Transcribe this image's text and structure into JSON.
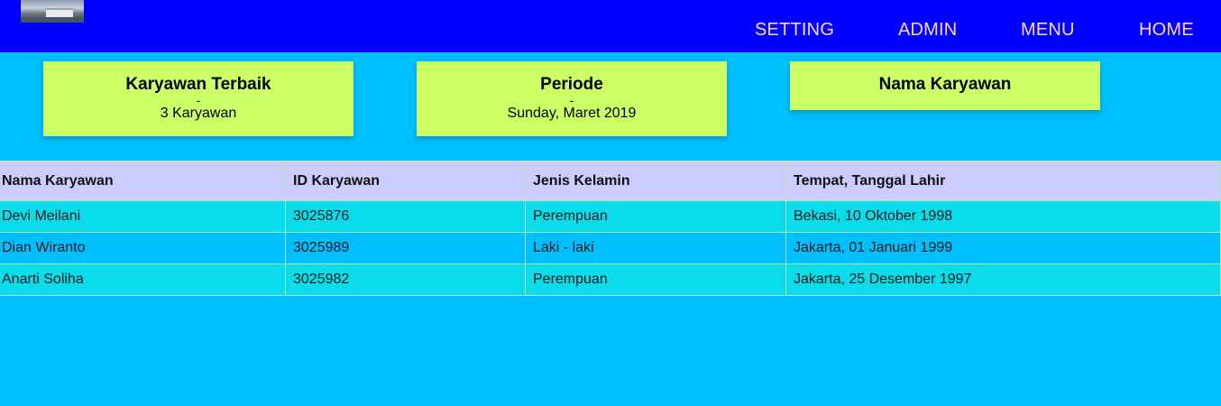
{
  "nav": {
    "links": [
      "SETTING",
      "ADMIN",
      "MENU",
      "HOME"
    ]
  },
  "cards": [
    {
      "title": "Karyawan Terbaik",
      "dash": "-",
      "value": "3 Karyawan"
    },
    {
      "title": "Periode",
      "dash": "-",
      "value": "Sunday, Maret 2019"
    },
    {
      "title": "Nama Karyawan"
    }
  ],
  "table": {
    "headers": [
      "Nama Karyawan",
      "ID Karyawan",
      "Jenis Kelamin",
      "Tempat, Tanggal Lahir"
    ],
    "rows": [
      [
        "Devi Meilani",
        "3025876",
        "Perempuan",
        "Bekasi, 10 Oktober 1998"
      ],
      [
        "Dian Wiranto",
        "3025989",
        "Laki - laki",
        "Jakarta, 01 Januari 1999"
      ],
      [
        "Anarti Soliha",
        "3025982",
        "Perempuan",
        "Jakarta, 25 Desember 1997"
      ]
    ]
  },
  "colors": {
    "navbar": "#0000ff",
    "page_background": "#00bfff",
    "card": "#ccff66",
    "table_header": "#ccccff",
    "row_odd": "#0adcec",
    "row_even": "#00bfff",
    "nav_text": "#ffd6d6"
  }
}
